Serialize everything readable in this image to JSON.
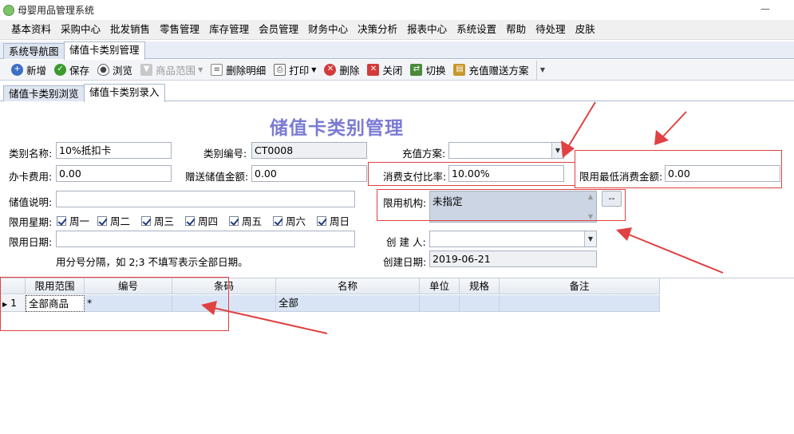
{
  "window": {
    "title": "母婴用品管理系统",
    "minimize": "—"
  },
  "menu": [
    "基本资料",
    "采购中心",
    "批发销售",
    "零售管理",
    "库存管理",
    "会员管理",
    "财务中心",
    "决策分析",
    "报表中心",
    "系统设置",
    "帮助",
    "待处理",
    "皮肤"
  ],
  "outer_tabs": [
    "系统导航图",
    "储值卡类别管理"
  ],
  "toolbar": [
    {
      "label": "新增",
      "icon": "add-icon",
      "color": "#3b6fc4"
    },
    {
      "label": "保存",
      "icon": "save-icon",
      "color": "#3c9a2e"
    },
    {
      "label": "浏览",
      "icon": "eye-icon",
      "color": "#555555"
    },
    {
      "label": "商品范围",
      "icon": "filter-icon",
      "color": "#b0b0b0"
    },
    {
      "label": "删除明细",
      "icon": "delete-detail-icon",
      "color": "#666666"
    },
    {
      "label": "打印",
      "icon": "print-icon",
      "color": "#555555"
    },
    {
      "label": "删除",
      "icon": "delete-icon",
      "color": "#d23b3b"
    },
    {
      "label": "关闭",
      "icon": "close-icon",
      "color": "#d23b3b"
    },
    {
      "label": "切换",
      "icon": "switch-icon",
      "color": "#4a8a3a"
    },
    {
      "label": "充值赠送方案",
      "icon": "gift-plan-icon",
      "color": "#c7972a"
    }
  ],
  "inner_tabs": [
    "储值卡类别浏览",
    "储值卡类别录入"
  ],
  "form": {
    "title": "储值卡类别管理",
    "category_name_label": "类别名称:",
    "category_name": "10%抵扣卡",
    "category_code_label": "类别编号:",
    "category_code": "CT0008",
    "recharge_plan_label": "充值方案:",
    "recharge_plan": "",
    "card_fee_label": "办卡费用:",
    "card_fee": "0.00",
    "gift_amount_label": "赠送储值金额:",
    "gift_amount": "0.00",
    "pay_ratio_label": "消费支付比率:",
    "pay_ratio": "10.00%",
    "min_amount_label": "限用最低消费金额:",
    "min_amount": "0.00",
    "note_label": "储值说明:",
    "note": "",
    "org_label": "限用机构:",
    "org_value": "未指定",
    "org_button": "--",
    "weekday_label": "限用星期:",
    "weekdays": [
      "周一",
      "周二",
      "周三",
      "周四",
      "周五",
      "周六",
      "周日"
    ],
    "date_label": "限用日期:",
    "date_value": "",
    "creator_label": "创 建 人:",
    "creator": "",
    "date_hint": "用分号分隔，如 2;3  不填写表示全部日期。",
    "created_date_label": "创建日期:",
    "created_date": "2019-06-21"
  },
  "grid": {
    "columns": [
      "限用范围",
      "编号",
      "条码",
      "名称",
      "单位",
      "规格",
      "备注"
    ],
    "rows": [
      {
        "index": "1",
        "scope": "全部商品",
        "code": "*",
        "barcode": "",
        "name": "全部",
        "unit": "",
        "spec": "",
        "remark": ""
      }
    ]
  },
  "colors": {
    "title": "#7b7bd4",
    "annotation": "#e04141",
    "row_highlight": "#d9e5f6"
  }
}
